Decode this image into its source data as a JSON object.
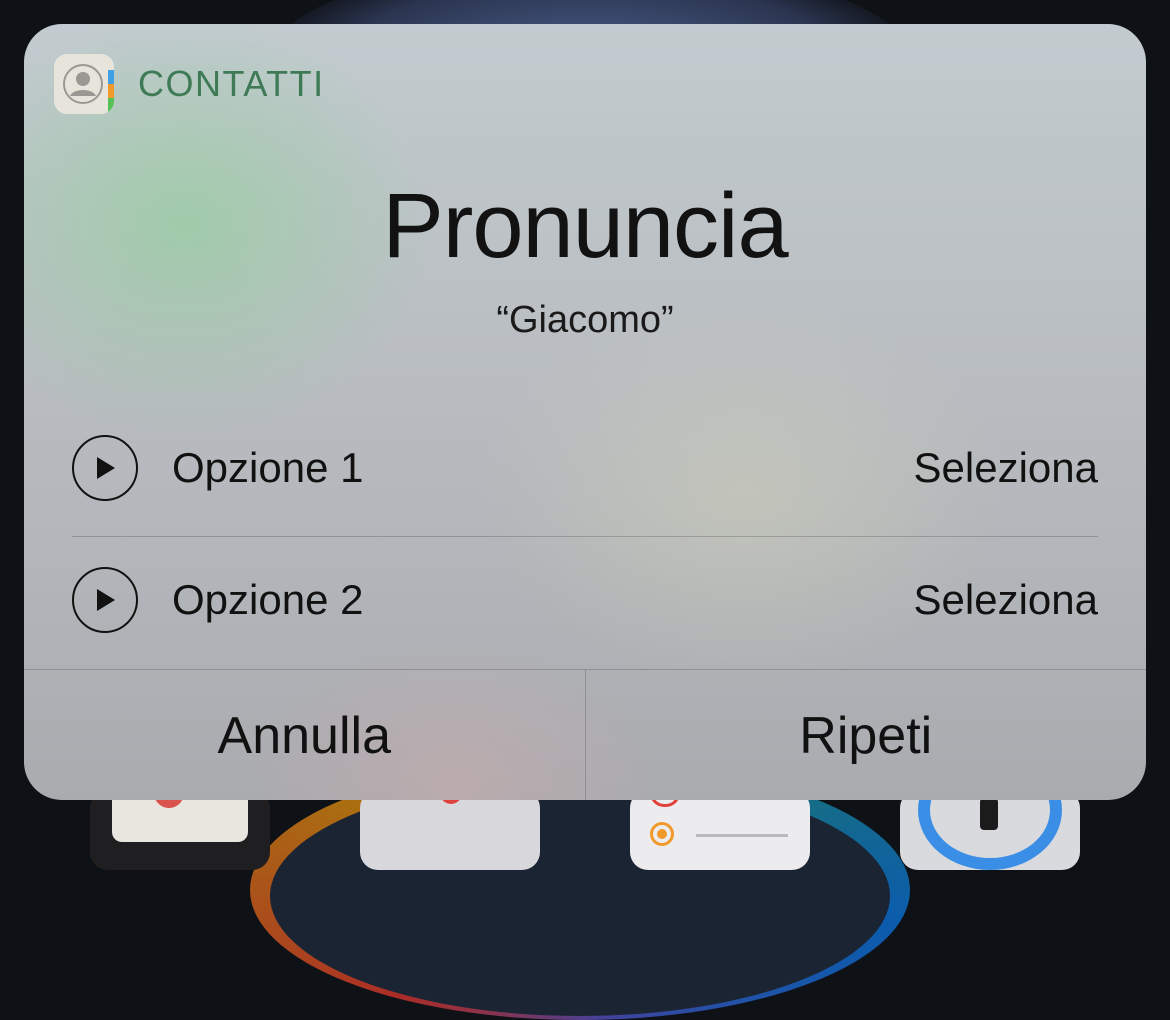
{
  "app": {
    "name": "CONTATTI",
    "icon": "contacts-icon"
  },
  "dialog": {
    "title": "Pronuncia",
    "subtitle": "“Giacomo”"
  },
  "options": [
    {
      "label": "Opzione 1",
      "action": "Seleziona",
      "icon": "play-icon"
    },
    {
      "label": "Opzione 2",
      "action": "Seleziona",
      "icon": "play-icon"
    }
  ],
  "buttons": {
    "cancel": "Annulla",
    "repeat": "Ripeti"
  },
  "colors": {
    "app_name": "#3f7a57",
    "text": "#111111"
  }
}
